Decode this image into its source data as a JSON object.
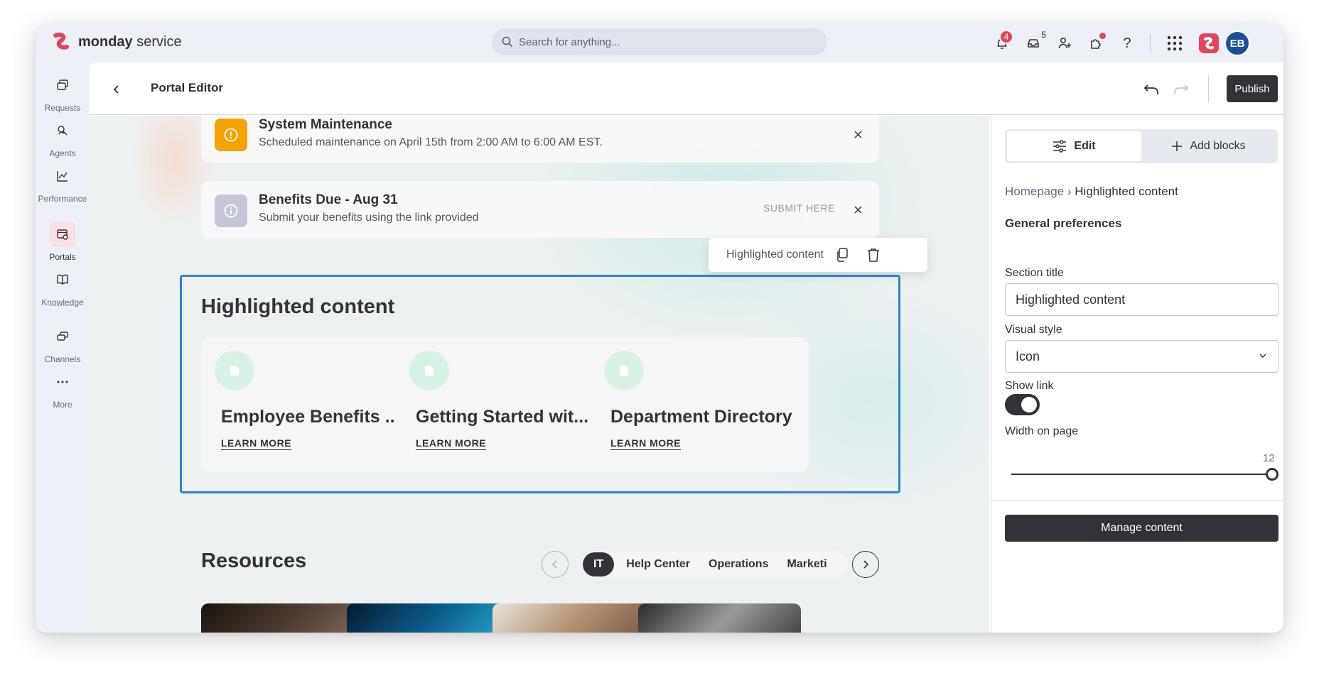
{
  "app": {
    "brand_bold": "monday",
    "brand_light": " service"
  },
  "search": {
    "placeholder": "Search for anything..."
  },
  "topbar": {
    "notifications_count": "4",
    "inbox_count": "5",
    "avatar_initials": "EB"
  },
  "rail": {
    "items": [
      {
        "label": "Requests",
        "icon": "requests-icon"
      },
      {
        "label": "Agents",
        "icon": "agents-icon"
      },
      {
        "label": "Performance",
        "icon": "performance-icon"
      },
      {
        "label": "Portals",
        "icon": "portals-icon"
      },
      {
        "label": "Knowledge",
        "icon": "knowledge-icon"
      },
      {
        "label": "Channels",
        "icon": "channels-icon"
      },
      {
        "label": "More",
        "icon": "more-icon"
      }
    ]
  },
  "editor": {
    "title": "Portal Editor",
    "publish_label": "Publish"
  },
  "notices": [
    {
      "title": "System Maintenance",
      "text": "Scheduled maintenance on April 15th from 2:00 AM to 6:00 AM EST.",
      "color": "#f5a300"
    },
    {
      "title": "Benefits Due - Aug 31",
      "text": "Submit your benefits using the link provided",
      "link": "SUBMIT HERE",
      "color": "#c5c7d8"
    }
  ],
  "float_toolbar": {
    "label": "Highlighted content"
  },
  "highlighted": {
    "title": "Highlighted content",
    "cards": [
      {
        "title": "Employee Benefits ...",
        "link": "LEARN MORE"
      },
      {
        "title": "Getting Started wit...",
        "link": "LEARN MORE"
      },
      {
        "title": "Department Directory",
        "link": "LEARN MORE"
      }
    ]
  },
  "resources": {
    "title": "Resources",
    "tabs": [
      "IT",
      "Help Center",
      "Operations",
      "Marketi"
    ]
  },
  "panel": {
    "edit_label": "Edit",
    "add_blocks_label": "Add blocks",
    "crumb_root": "Homepage",
    "crumb_sep": " › ",
    "crumb_current": "Highlighted content",
    "general_preferences": "General preferences",
    "section_title_label": "Section title",
    "section_title_value": "Highlighted content",
    "visual_style_label": "Visual style",
    "visual_style_value": "Icon",
    "show_link_label": "Show link",
    "show_link_on": true,
    "width_label": "Width on page",
    "width_value": "12",
    "manage_label": "Manage content"
  },
  "colors": {
    "accent": "#2f7fd6",
    "dark": "#323338",
    "brand": "#e2445c"
  }
}
